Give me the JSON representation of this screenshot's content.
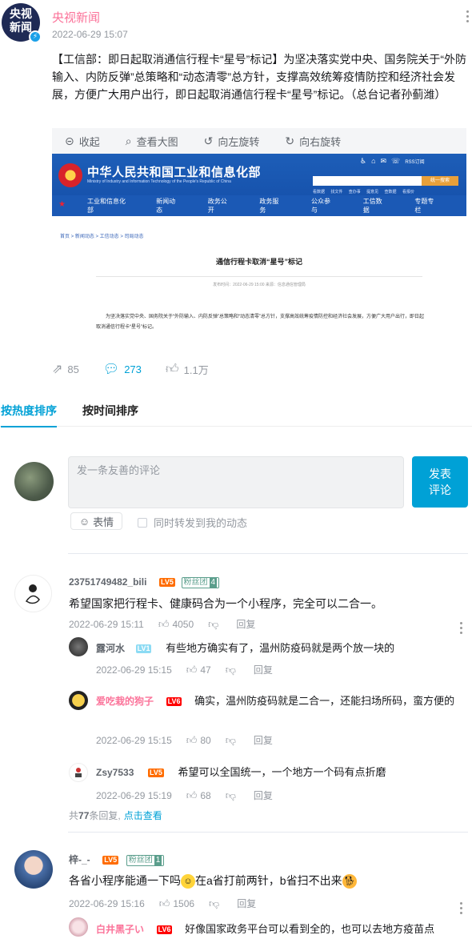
{
  "post": {
    "avatar_text_1": "央视",
    "avatar_text_2": "新闻",
    "author": "央视新闻",
    "time": "2022-06-29 15:07",
    "content": "【工信部：即日起取消通信行程卡“星号”标记】为坚决落实党中央、国务院关于“外防输入、内防反弹”总策略和“动态清零”总方针，支撑高效统筹疫情防控和经济社会发展，方便广大用户出行，即日起取消通信行程卡“星号”标记。（总台记者孙蓟潍）"
  },
  "viewer": {
    "tools": [
      {
        "icon": "collapse-icon",
        "label": "收起"
      },
      {
        "icon": "search-icon",
        "label": "查看大图"
      },
      {
        "icon": "rotate-left-icon",
        "label": "向左旋转"
      },
      {
        "icon": "rotate-right-icon",
        "label": "向右旋转"
      }
    ]
  },
  "screenshot": {
    "site_title": "中华人民共和国工业和信息化部",
    "site_subtitle": "Ministry of Industry and Information Technology of the People's Republic of China",
    "rss": "RSS订阅",
    "search_button": "统一搜索",
    "quick_links": "看数据 找文件 查办事 提意见 查数据 看报价",
    "nav": [
      "工业和信息化部",
      "新闻动态",
      "政务公开",
      "政务服务",
      "公众参与",
      "工信数据",
      "专题专栏"
    ],
    "breadcrumb": "首页 > 新闻动态 > 工信动态 > 司局动态",
    "article_title": "通信行程卡取消“星号”标记",
    "article_meta": "发布时间：2022-06-29 15:00    来源：信息通信管理局",
    "article_body": "为坚决落实党中央、国务院关于“外防输入、内防反弹”总策略和“动态清零”总方针，支撑高效统筹疫情防控和经济社会发展，方便广大用户出行，即日起取消通信行程卡“星号”标记。"
  },
  "stats": {
    "shares": "85",
    "comments": "273",
    "likes": "1.1万"
  },
  "sort_tabs": {
    "hot": "按热度排序",
    "time": "按时间排序"
  },
  "composer": {
    "placeholder": "发一条友善的评论",
    "post_line1": "发表",
    "post_line2": "评论",
    "emoji_label": "表情",
    "repost_label": "同时转发到我的动态"
  },
  "comments": [
    {
      "user": "23751749482_bili",
      "level": "LV5",
      "fans_label": "粉丝团",
      "fans_level": "4",
      "text": "希望国家把行程卡、健康码合为一个小程序，完全可以二合一。",
      "time": "2022-06-29 15:11",
      "likes": "4050",
      "reply_label": "回复",
      "replies": [
        {
          "user": "露河水",
          "level": "LV1",
          "text": "有些地方确实有了，温州防疫码就是两个放一块的",
          "time": "2022-06-29 15:15",
          "likes": "47",
          "reply_label": "回复"
        },
        {
          "user": "爱吃栽的狗子",
          "level": "LV6",
          "text": "确实，温州防疫码就是二合一，还能扫场所码，蛮方便的",
          "time": "2022-06-29 15:15",
          "likes": "80",
          "reply_label": "回复"
        },
        {
          "user": "Zsy7533",
          "level": "LV5",
          "text": "希望可以全国统一，一个地方一个码有点折磨",
          "time": "2022-06-29 15:19",
          "likes": "68",
          "reply_label": "回复"
        }
      ],
      "more_prefix": "共",
      "more_count": "77",
      "more_suffix": "条回复,",
      "more_link": "点击查看"
    },
    {
      "user": "梓-_-",
      "level": "LV5",
      "fans_label": "粉丝团",
      "fans_level": "1",
      "text_a": "各省小程序能通一下吗",
      "text_b": "在a省打前两针，b省扫不出来",
      "time": "2022-06-29 15:16",
      "likes": "1506",
      "reply_label": "回复",
      "replies": [
        {
          "user": "白井黑子い",
          "level": "LV6",
          "text": "好像国家政务平台可以看到全的，也可以去地方疫苗点"
        }
      ]
    }
  ]
}
